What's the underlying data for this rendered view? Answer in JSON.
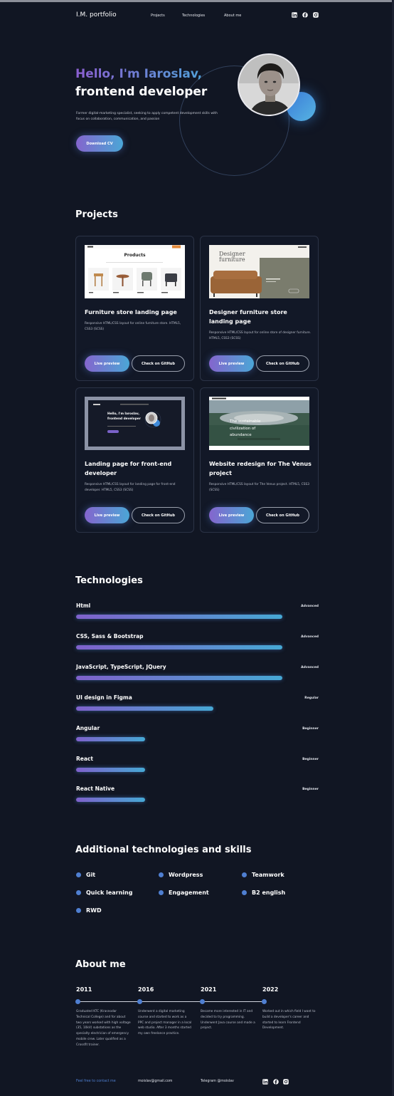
{
  "header": {
    "logo": "I.M. portfolio",
    "nav": [
      "Projects",
      "Technologies",
      "About me"
    ],
    "social_icons": [
      "linkedin-icon",
      "facebook-icon",
      "instagram-icon"
    ]
  },
  "hero": {
    "greeting": "Hello, I'm Iaroslav,",
    "role": "frontend developer",
    "description": "Former digital-marketing specialist, seeking to apply competent development skills with focus on collaboration, communication, and passion",
    "cta": "Download CV"
  },
  "projects": {
    "title": "Projects",
    "items": [
      {
        "title": "Furniture store landing page",
        "description": "Responsive HTML/CSS layout for online furniture store. HTML5, CSS3 (SCSS)",
        "preview_label": "Live preview",
        "github_label": "Check on GitHub",
        "thumb_heading": "Products"
      },
      {
        "title": "Designer furniture store landing page",
        "description": "Responsive HTML/CSS layout for online store of designer furniture. HTML5, CSS3 (SCSS)",
        "preview_label": "Live preview",
        "github_label": "Check on GitHub",
        "thumb_heading": "Designer furniture"
      },
      {
        "title": "Landing page for front-end developer",
        "description": "Responsive HTML/CSS layout for landing page for front-end developer. HTML5, CSS3 (SCSS)",
        "preview_label": "Live preview",
        "github_label": "Check on GitHub",
        "thumb_heading": "Hello, I'm Iaroslav, frontend developer"
      },
      {
        "title": "Website redesign for The Venus project",
        "description": "Responsive HTML/CSS layout for The Venus project. HTML5, CSS3 (SCSS)",
        "preview_label": "Live preview",
        "github_label": "Check on GitHub",
        "thumb_heading": "The sustainable civilization of abundance"
      }
    ]
  },
  "technologies": {
    "title": "Technologies",
    "items": [
      {
        "name": "Html",
        "level": "Advanced",
        "progress": 0.85
      },
      {
        "name": "CSS, Sass & Bootstrap",
        "level": "Advanced",
        "progress": 0.85
      },
      {
        "name": "JavaScript, TypeScript, JQuery",
        "level": "Advanced",
        "progress": 0.85
      },
      {
        "name": "UI design in Figma",
        "level": "Regular",
        "progress": 0.565
      },
      {
        "name": "Angular",
        "level": "Beginner",
        "progress": 0.285
      },
      {
        "name": "React",
        "level": "Beginner",
        "progress": 0.285
      },
      {
        "name": "React Native",
        "level": "Beginner",
        "progress": 0.285
      }
    ]
  },
  "skills": {
    "title": "Additional technologies and skills",
    "items": [
      "Git",
      "Wordpress",
      "Teamwork",
      "Quick learning",
      "Engagement",
      "B2 english",
      "RWD"
    ]
  },
  "about": {
    "title": "About me",
    "timeline": [
      {
        "year": "2011",
        "text": "Graduated KTC (Krasnodar Technical College) and for about two years worked with high voltage (35, 10kV) substations as the specialty electrician of emergency mobile crew. Later qualified as a Crossfit trainer."
      },
      {
        "year": "2016",
        "text": "Underwent a digital marketing course and started to work as a PPC and project manager in a local web studio. After 3 months started my own freelance practice."
      },
      {
        "year": "2021",
        "text": "Became more interested in IT and decided to try programming. Underwent Java course and made a project."
      },
      {
        "year": "2022",
        "text": "Worked out in which field I want to build a developer's career and started to learn Frontend Development."
      }
    ]
  },
  "footer": {
    "contact_label": "Feel free to contact me",
    "email": "moislav@gmail.com",
    "telegram": "Telegram @moislav"
  },
  "colors": {
    "background": "#111623",
    "accent_start": "#8465cd",
    "accent_end": "#4ba6d6",
    "dot": "#4f7fd1"
  }
}
